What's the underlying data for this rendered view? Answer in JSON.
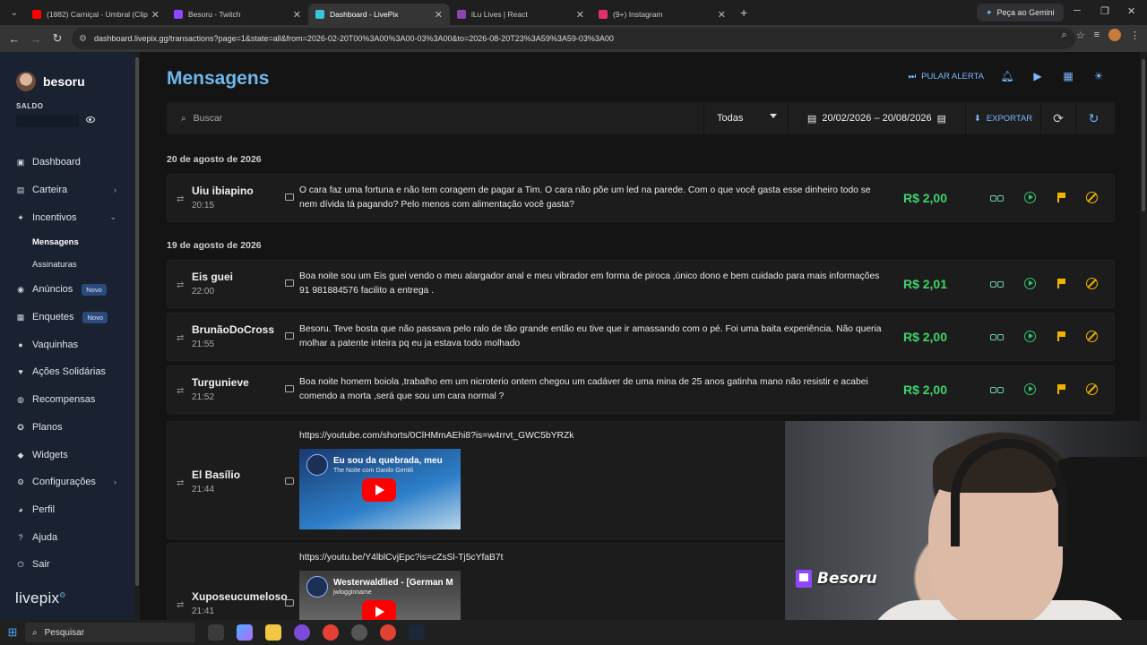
{
  "browser": {
    "tabs": [
      {
        "title": "(1882) Carniçal - Umbral (Clipe",
        "color": "#ff0000"
      },
      {
        "title": "Besoru - Twitch",
        "color": "#9146ff"
      },
      {
        "title": "Dashboard - LivePix",
        "color": "#37c6d9"
      },
      {
        "title": "iLu Lives | React",
        "color": "#8e44ad"
      },
      {
        "title": "(9+) Instagram",
        "color": "#e1306c"
      }
    ],
    "gemini_label": "Peça ao Gemini",
    "url": "dashboard.livepix.gg/transactions?page=1&state=all&from=2026-02-20T00%3A00%3A00-03%3A00&to=2026-08-20T23%3A59%3A59-03%3A00"
  },
  "sidebar": {
    "username": "besoru",
    "saldo_label": "SALDO",
    "items": [
      {
        "label": "Dashboard",
        "icon": "dashboard-icon",
        "glyph": "▣"
      },
      {
        "label": "Carteira",
        "icon": "wallet-icon",
        "glyph": "▤",
        "chevron": "›"
      },
      {
        "label": "Incentivos",
        "icon": "sparkle-icon",
        "glyph": "✦",
        "chevron": "⌄"
      }
    ],
    "sub_items": [
      {
        "label": "Mensagens"
      },
      {
        "label": "Assinaturas"
      }
    ],
    "items2": [
      {
        "label": "Anúncios",
        "icon": "megaphone-icon",
        "glyph": "◉",
        "badge": "Novo"
      },
      {
        "label": "Enquetes",
        "icon": "poll-icon",
        "glyph": "▦",
        "badge": "Novo"
      },
      {
        "label": "Vaquinhas",
        "icon": "piggy-icon",
        "glyph": "●"
      },
      {
        "label": "Ações Solidárias",
        "icon": "heart-hand-icon",
        "glyph": "♥"
      },
      {
        "label": "Recompensas",
        "icon": "gift-icon",
        "glyph": "◍"
      },
      {
        "label": "Planos",
        "icon": "star-icon",
        "glyph": "✪"
      },
      {
        "label": "Widgets",
        "icon": "widget-icon",
        "glyph": "◆"
      },
      {
        "label": "Configurações",
        "icon": "gear-icon",
        "glyph": "⚙",
        "chevron": "›"
      },
      {
        "label": "Perfil",
        "icon": "user-icon",
        "glyph": "◕"
      },
      {
        "label": "Ajuda",
        "icon": "help-icon",
        "glyph": "?"
      },
      {
        "label": "Sair",
        "icon": "logout-icon",
        "glyph": "⏻"
      }
    ],
    "logo": "livepix"
  },
  "header": {
    "title": "Mensagens",
    "pular_alerta": "PULAR ALERTA"
  },
  "filters": {
    "search_placeholder": "Buscar",
    "state": "Todas",
    "date_range": "20/02/2026 – 20/08/2026",
    "export_label": "EXPORTAR"
  },
  "groups": [
    {
      "date": "20 de agosto de 2026"
    },
    {
      "date": "19 de agosto de 2026"
    }
  ],
  "messages": [
    {
      "name": "Uiu ibiapino",
      "time": "20:15",
      "text": "O cara faz uma fortuna e não tem coragem de pagar a Tim. O cara não põe um led na parede. Com o que você gasta esse dinheiro todo se nem dívida tá pagando? Pelo menos com alimentação você gasta?",
      "amount": "R$ 2,00"
    },
    {
      "name": "Eis guei",
      "time": "22:00",
      "text": "Boa noite sou um Eis guei vendo o meu alargador anal e meu vibrador em forma de piroca ,único dono e bem cuidado para mais informações 91 981884576 facilito a entrega .",
      "amount": "R$ 2,01"
    },
    {
      "name": "BrunãoDoCross",
      "time": "21:55",
      "text": "Besoru. Teve bosta que não passava pelo ralo de tão grande então eu tive que ir amassando com o pé. Foi uma baita experiência. Não queria molhar a patente inteira pq eu ja estava todo molhado",
      "amount": "R$ 2,00"
    },
    {
      "name": "Turgunieve",
      "time": "21:52",
      "text": "Boa noite homem boiola ,trabalho em um nicroterio ontem chegou um cadáver de uma mina de 25 anos gatinha mano não resistir e acabei comendo a morta ,será que sou um cara normal ?",
      "amount": "R$ 2,00"
    }
  ],
  "videos": [
    {
      "name": "El Basílio",
      "time": "21:44",
      "link": "https://youtube.com/shorts/0ClHMmAEhi8?is=w4rrvt_GWC5bYRZk",
      "video_title": "Eu sou da quebrada, meu",
      "channel": "The Noite com Danilo Gentili"
    },
    {
      "name": "Xuposeucumeloso",
      "time": "21:41",
      "link": "https://youtu.be/Y4lblCvjEpc?is=cZsSl-Tj5cYfaB7t",
      "video_title": "Westerwaldlied - [German M",
      "channel": "jwlogginname"
    }
  ],
  "webcam": {
    "channel_name": "Besoru"
  },
  "taskbar": {
    "search_placeholder": "Pesquisar"
  }
}
